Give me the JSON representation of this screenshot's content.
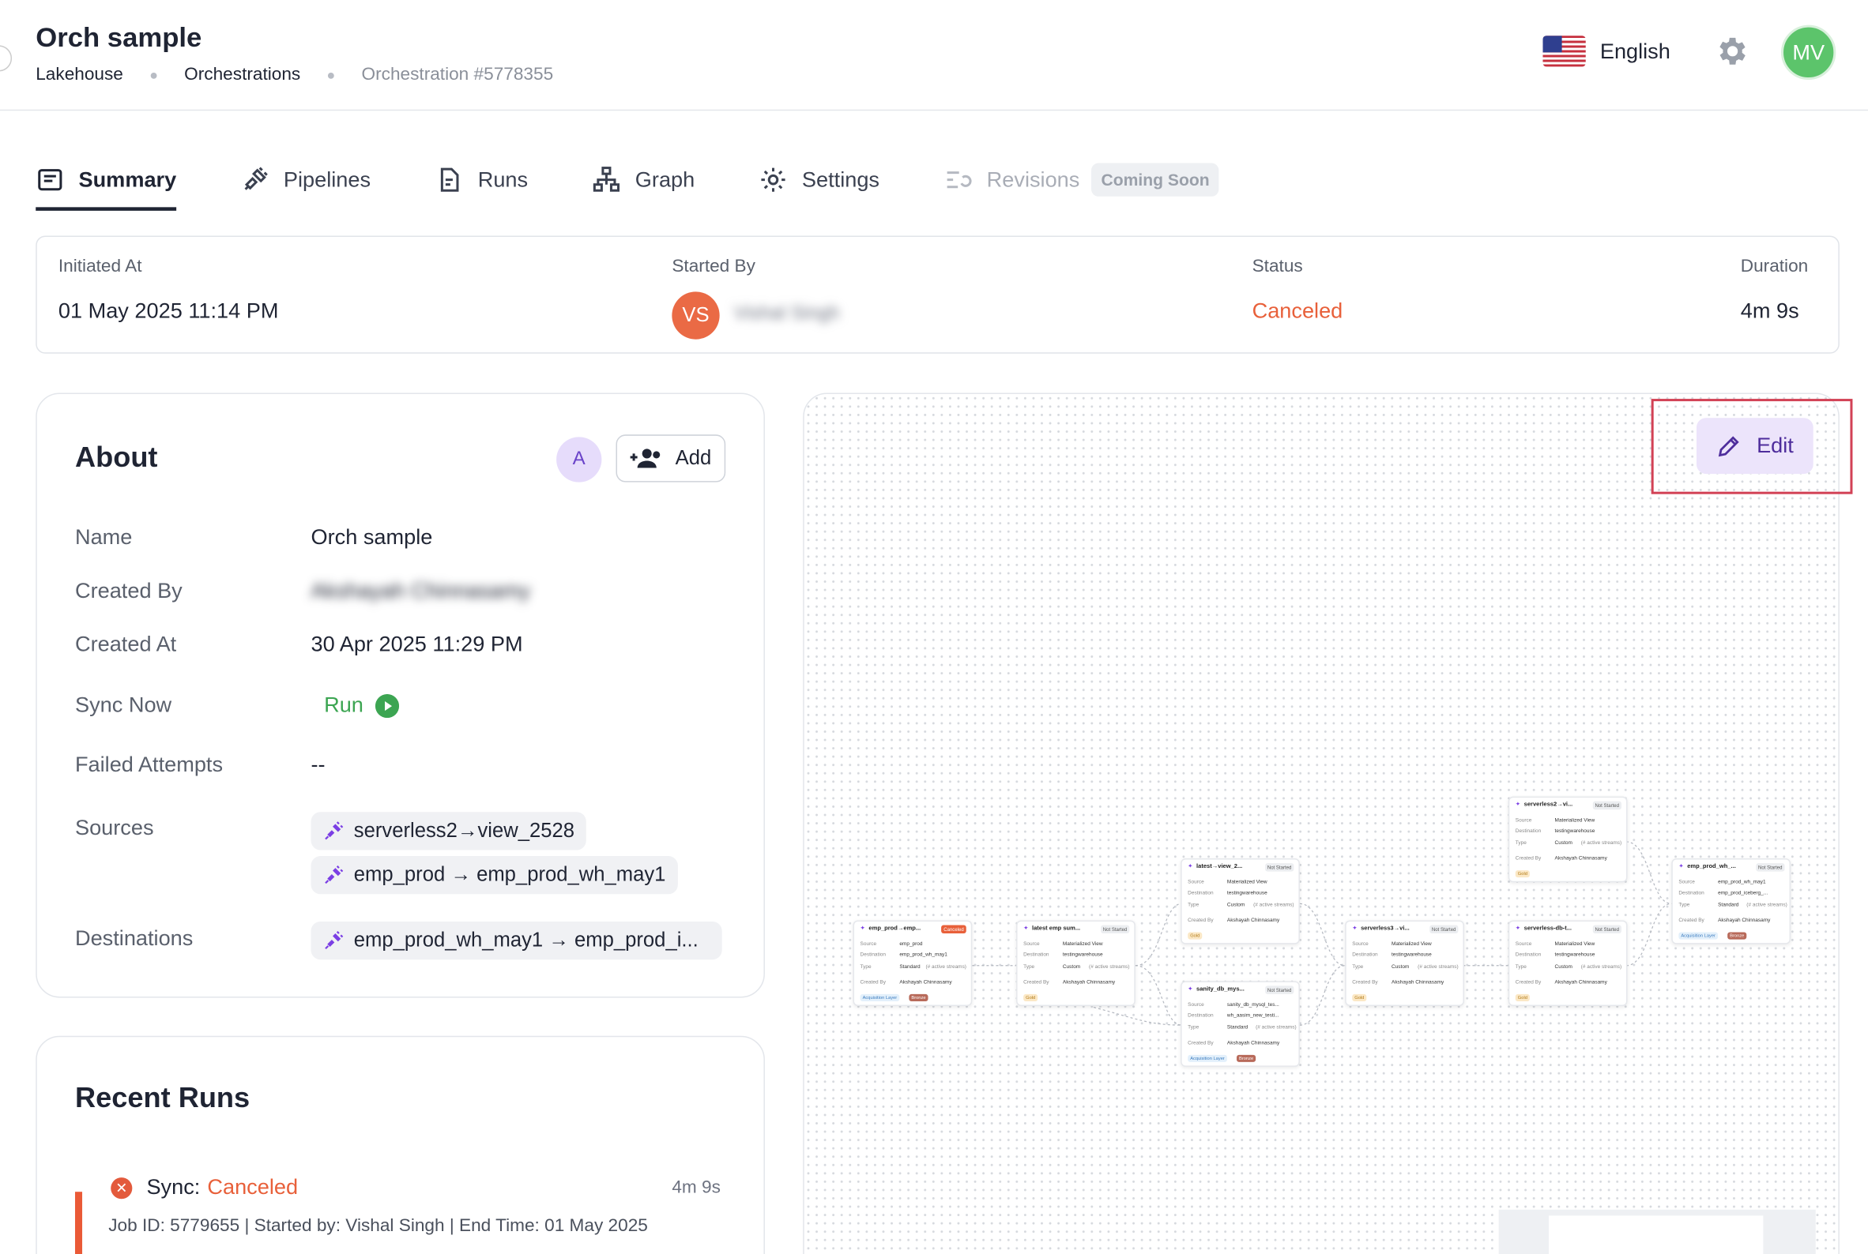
{
  "header": {
    "title": "Orch sample",
    "breadcrumbs": [
      "Lakehouse",
      "Orchestrations",
      "Orchestration #5778355"
    ],
    "language": "English",
    "user_initials": "MV"
  },
  "tabs": [
    {
      "label": "Summary",
      "icon": "summary-icon",
      "active": true
    },
    {
      "label": "Pipelines",
      "icon": "plug-icon"
    },
    {
      "label": "Runs",
      "icon": "document-icon"
    },
    {
      "label": "Graph",
      "icon": "hierarchy-icon"
    },
    {
      "label": "Settings",
      "icon": "gear-icon"
    },
    {
      "label": "Revisions",
      "icon": "revisions-icon",
      "disabled": true,
      "badge": "Coming Soon"
    }
  ],
  "stats": {
    "initiated_label": "Initiated At",
    "initiated_value": "01 May 2025 11:14 PM",
    "started_by_label": "Started By",
    "started_by_initials": "VS",
    "started_by_name": "Vishal Singh",
    "status_label": "Status",
    "status_value": "Canceled",
    "status_color": "#e8603a",
    "duration_label": "Duration",
    "duration_value": "4m 9s"
  },
  "about": {
    "title": "About",
    "owner_initial": "A",
    "add_label": "Add",
    "name_label": "Name",
    "name_value": "Orch sample",
    "created_by_label": "Created By",
    "created_by_value": "Akshayah Chinnasamy",
    "created_at_label": "Created At",
    "created_at_value": "30 Apr 2025 11:29 PM",
    "sync_label": "Sync Now",
    "sync_value": "Run",
    "failed_label": "Failed Attempts",
    "failed_value": "--",
    "sources_label": "Sources",
    "sources": [
      "serverless2→view_2528",
      "emp_prod → emp_prod_wh_may1"
    ],
    "destinations_label": "Destinations",
    "destinations": [
      "emp_prod_wh_may1 → emp_prod_i..."
    ]
  },
  "recent_runs": {
    "title": "Recent Runs",
    "items": [
      {
        "prefix": "Sync:",
        "status": "Canceled",
        "duration": "4m 9s",
        "meta": "Job ID: 5779655 | Started by: Vishal Singh | End Time: 01 May 2025"
      }
    ]
  },
  "graph": {
    "edit_label": "Edit",
    "labels": {
      "source": "Source",
      "destination": "Destination",
      "type": "Type",
      "created_by": "Created By",
      "streams_suffix": "(# active streams)"
    },
    "nodes": [
      {
        "title": "emp_prod→emp...",
        "status": "Canceled",
        "source": "emp_prod",
        "destination": "emp_prod_wh_may1",
        "type": "Standard",
        "created_by": "Akshayah Chinnasamy",
        "tags": [
          "Acquisition Layer",
          "Bronze"
        ]
      },
      {
        "title": "latest emp sum...",
        "status": "Not Started",
        "source": "Materialized View",
        "destination": "testingwarehouse",
        "type": "Custom",
        "created_by": "Akshayah Chinnasamy",
        "tags": [
          "Gold"
        ]
      },
      {
        "title": "latest→view_2...",
        "status": "Not Started",
        "source": "Materialized View",
        "destination": "testingwarehouse",
        "type": "Custom",
        "created_by": "Akshayah Chinnasamy",
        "tags": [
          "Gold"
        ]
      },
      {
        "title": "sanity_db_mys...",
        "status": "Not Started",
        "source": "sanity_db_mysql_tes...",
        "destination": "wh_aasim_new_testi...",
        "type": "Standard",
        "created_by": "Akshayah Chinnasamy",
        "tags": [
          "Acquisition Layer",
          "Bronze"
        ]
      },
      {
        "title": "serverless3→vi...",
        "status": "Not Started",
        "source": "Materialized View",
        "destination": "testingwarehouse",
        "type": "Custom",
        "created_by": "Akshayah Chinnasamy",
        "tags": [
          "Gold"
        ]
      },
      {
        "title": "serverless2→vi...",
        "status": "Not Started",
        "source": "Materialized View",
        "destination": "testingwarehouse",
        "type": "Custom",
        "created_by": "Akshayah Chinnasamy",
        "tags": [
          "Gold"
        ]
      },
      {
        "title": "serverless-db-t...",
        "status": "Not Started",
        "source": "Materialized View",
        "destination": "testingwarehouse",
        "type": "Custom",
        "created_by": "Akshayah Chinnasamy",
        "tags": [
          "Gold"
        ]
      },
      {
        "title": "emp_prod_wh_...",
        "status": "Not Started",
        "source": "emp_prod_wh_may1",
        "destination": "emp_prod_iceberg_...",
        "type": "Standard",
        "created_by": "Akshayah Chinnasamy",
        "tags": [
          "Acquisition Layer",
          "Bronze"
        ]
      }
    ]
  }
}
